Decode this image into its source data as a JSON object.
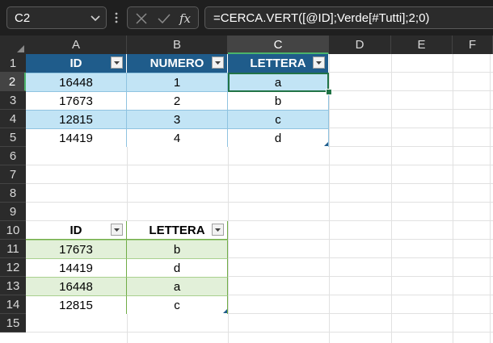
{
  "formula_bar": {
    "name_box": "C2",
    "formula": "=CERCA.VERT([@ID];Verde[#Tutti];2;0)"
  },
  "columns": [
    "A",
    "B",
    "C",
    "D",
    "E",
    "F"
  ],
  "rows": [
    "1",
    "2",
    "3",
    "4",
    "5",
    "6",
    "7",
    "8",
    "9",
    "10",
    "11",
    "12",
    "13",
    "14",
    "15"
  ],
  "selected": {
    "column": "C",
    "row": "2"
  },
  "table_blue": {
    "headers": [
      "ID",
      "NUMERO",
      "LETTERA"
    ],
    "rows": [
      [
        "16448",
        "1",
        "a"
      ],
      [
        "17673",
        "2",
        "b"
      ],
      [
        "12815",
        "3",
        "c"
      ],
      [
        "14419",
        "4",
        "d"
      ]
    ],
    "colors": {
      "header": "#1f5c8b",
      "band": "#c2e4f5"
    }
  },
  "table_green": {
    "headers": [
      "ID",
      "LETTERA"
    ],
    "rows": [
      [
        "17673",
        "b"
      ],
      [
        "14419",
        "d"
      ],
      [
        "16448",
        "a"
      ],
      [
        "12815",
        "c"
      ]
    ],
    "colors": {
      "band": "#e2f0d9",
      "border": "#70ad47"
    }
  },
  "icons": [
    "chevron-down-icon",
    "more-vertical-icon",
    "cancel-icon",
    "enter-check-icon",
    "insert-function-icon",
    "filter-dropdown-icon",
    "table-resize-icon",
    "select-all-icon"
  ]
}
